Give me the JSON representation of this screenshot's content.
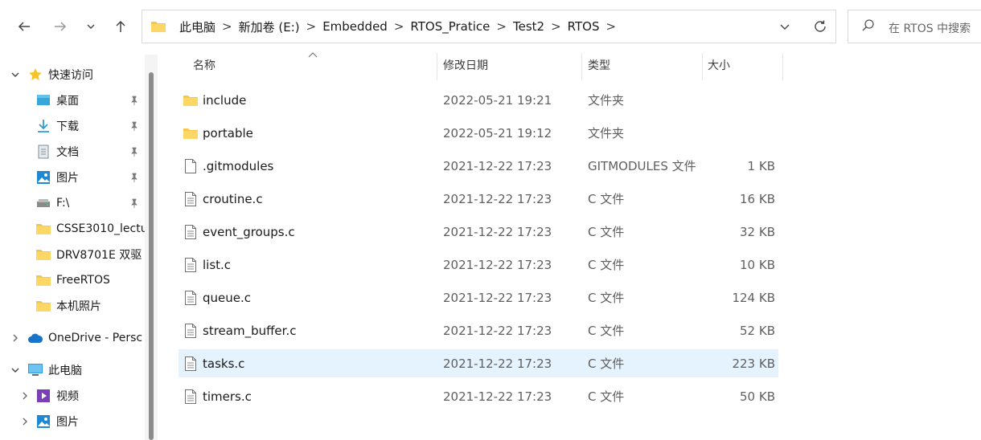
{
  "toolbar": {
    "back_icon": "arrow-left-icon",
    "forward_icon": "arrow-right-icon",
    "recent_icon": "chevron-down-icon",
    "up_icon": "arrow-up-icon"
  },
  "address": {
    "crumbs": [
      "此电脑",
      "新加卷 (E:)",
      "Embedded",
      "RTOS_Pratice",
      "Test2",
      "RTOS"
    ],
    "separator": ">"
  },
  "search": {
    "placeholder": "在 RTOS 中搜索"
  },
  "sidebar": {
    "items": [
      {
        "label": "快速访问",
        "icon": "star-icon",
        "expanded": true
      },
      {
        "label": "桌面",
        "icon": "desktop-icon",
        "pinned": true
      },
      {
        "label": "下载",
        "icon": "download-icon",
        "pinned": true
      },
      {
        "label": "文档",
        "icon": "document-icon",
        "pinned": true
      },
      {
        "label": "图片",
        "icon": "picture-icon",
        "pinned": true
      },
      {
        "label": "F:\\",
        "icon": "drive-icon",
        "pinned": true
      },
      {
        "label": "CSSE3010_lectu",
        "icon": "folder-icon"
      },
      {
        "label": "DRV8701E 双驱",
        "icon": "folder-icon"
      },
      {
        "label": "FreeRTOS",
        "icon": "folder-icon"
      },
      {
        "label": "本机照片",
        "icon": "folder-icon"
      },
      {
        "label": "OneDrive - Persc",
        "icon": "cloud-icon",
        "expanded": false
      },
      {
        "label": "此电脑",
        "icon": "computer-icon",
        "expanded": true
      },
      {
        "label": "视频",
        "icon": "video-icon",
        "expanded": false
      },
      {
        "label": "图片",
        "icon": "picture-icon",
        "expanded": false
      }
    ]
  },
  "columns": {
    "name": "名称",
    "modified": "修改日期",
    "type": "类型",
    "size": "大小"
  },
  "files": [
    {
      "name": "include",
      "modified": "2022-05-21 19:21",
      "type": "文件夹",
      "size": "",
      "icon": "folder-icon"
    },
    {
      "name": "portable",
      "modified": "2022-05-21 19:12",
      "type": "文件夹",
      "size": "",
      "icon": "folder-icon"
    },
    {
      "name": ".gitmodules",
      "modified": "2021-12-22 17:23",
      "type": "GITMODULES 文件",
      "size": "1 KB",
      "icon": "file-icon"
    },
    {
      "name": "croutine.c",
      "modified": "2021-12-22 17:23",
      "type": "C 文件",
      "size": "16 KB",
      "icon": "file-icon"
    },
    {
      "name": "event_groups.c",
      "modified": "2021-12-22 17:23",
      "type": "C 文件",
      "size": "32 KB",
      "icon": "file-icon"
    },
    {
      "name": "list.c",
      "modified": "2021-12-22 17:23",
      "type": "C 文件",
      "size": "10 KB",
      "icon": "file-icon"
    },
    {
      "name": "queue.c",
      "modified": "2021-12-22 17:23",
      "type": "C 文件",
      "size": "124 KB",
      "icon": "file-icon"
    },
    {
      "name": "stream_buffer.c",
      "modified": "2021-12-22 17:23",
      "type": "C 文件",
      "size": "52 KB",
      "icon": "file-icon"
    },
    {
      "name": "tasks.c",
      "modified": "2021-12-22 17:23",
      "type": "C 文件",
      "size": "223 KB",
      "icon": "file-icon",
      "selected": true
    },
    {
      "name": "timers.c",
      "modified": "2021-12-22 17:23",
      "type": "C 文件",
      "size": "50 KB",
      "icon": "file-icon"
    }
  ],
  "colors": {
    "selected_row": "#e5f3ff",
    "folder": "#f8c74a",
    "accent": "#0078d4"
  }
}
